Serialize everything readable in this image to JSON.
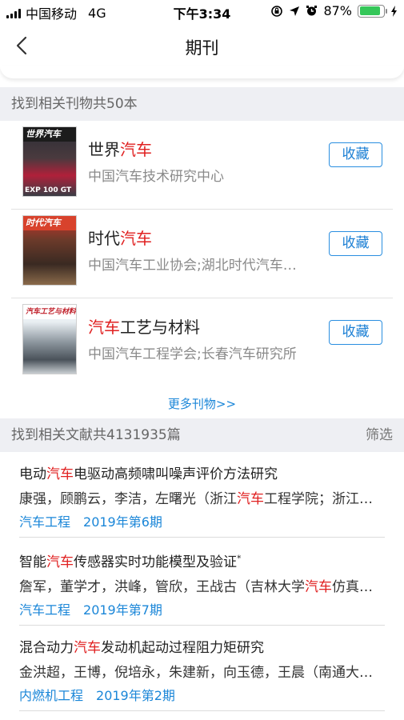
{
  "status": {
    "carrier": "中国移动",
    "network": "4G",
    "time": "下午3:34",
    "battery": "87%",
    "battery_level": 0.87
  },
  "nav": {
    "title": "期刊"
  },
  "journal_section": {
    "header": "找到相关刊物共50本"
  },
  "journals": [
    {
      "title_pre": "世界",
      "title_hl": "汽车",
      "title_post": "",
      "publisher": "中国汽车技术研究中心",
      "collect_label": "收藏",
      "cover_name": "世界汽车",
      "cover_sub": "EXP 100 GT"
    },
    {
      "title_pre": "时代",
      "title_hl": "汽车",
      "title_post": "",
      "publisher": "中国汽车工业协会;湖北时代汽车…",
      "collect_label": "收藏",
      "cover_name": "时代汽车",
      "cover_sub": ""
    },
    {
      "title_pre": "",
      "title_hl": "汽车",
      "title_post": "工艺与材料",
      "publisher": "中国汽车工程学会;长春汽车研究所",
      "collect_label": "收藏",
      "cover_name": "汽车工艺与材料",
      "cover_sub": ""
    }
  ],
  "more_journals": "更多刊物>>",
  "article_section": {
    "header": "找到相关文献共4131935篇",
    "filter_label": "筛选"
  },
  "articles": [
    {
      "title_pre": "电动",
      "title_hl": "汽车",
      "title_post": "电驱动高频啸叫噪声评价方法研究",
      "title_sup": "",
      "authors_pre": "康强，顾鹏云，李洁，左曙光（浙江",
      "authors_hl": "汽车",
      "authors_post": "工程学院；浙江…",
      "journal": "汽车工程",
      "issue": "2019年第6期"
    },
    {
      "title_pre": "智能",
      "title_hl": "汽车",
      "title_post": "传感器实时功能模型及验证",
      "title_sup": "*",
      "authors_pre": "詹军，董学才，洪峰，管欣，王战古（吉林大学",
      "authors_hl": "汽车",
      "authors_post": "仿真…",
      "journal": "汽车工程",
      "issue": "2019年第7期"
    },
    {
      "title_pre": "混合动力",
      "title_hl": "汽车",
      "title_post": "发动机起动过程阻力矩研究",
      "title_sup": "",
      "authors_pre": "金洪超，王博，倪培永，朱建新，向玉德，王晨（南通大…",
      "authors_hl": "",
      "authors_post": "",
      "journal": "内燃机工程",
      "issue": "2019年第2期"
    }
  ]
}
